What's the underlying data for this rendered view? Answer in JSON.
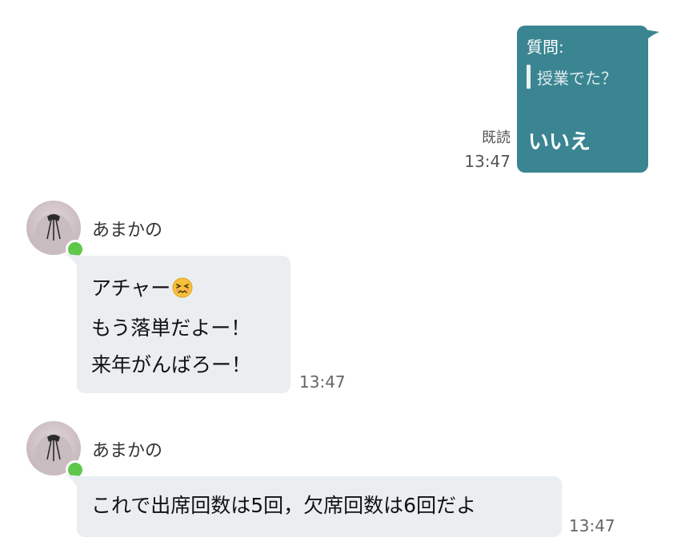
{
  "outgoing": {
    "quote_header": "質問:",
    "quote_text": "授業でた？",
    "message": "いいえ",
    "read_label": "既読",
    "time": "13:47"
  },
  "incoming": [
    {
      "sender": "あまかの",
      "lines": [
        "アチャー",
        "もう落単だよー！",
        "来年がんばろー！"
      ],
      "emoji": "confounded-face-emoji",
      "time": "13:47"
    },
    {
      "sender": "あまかの",
      "lines": [
        "これで出席回数は5回，欠席回数は6回だよ"
      ],
      "time": "13:47"
    }
  ],
  "colors": {
    "outgoing_bubble": "#3a8591",
    "incoming_bubble": "#ebeef1",
    "online": "#5fc84a"
  }
}
